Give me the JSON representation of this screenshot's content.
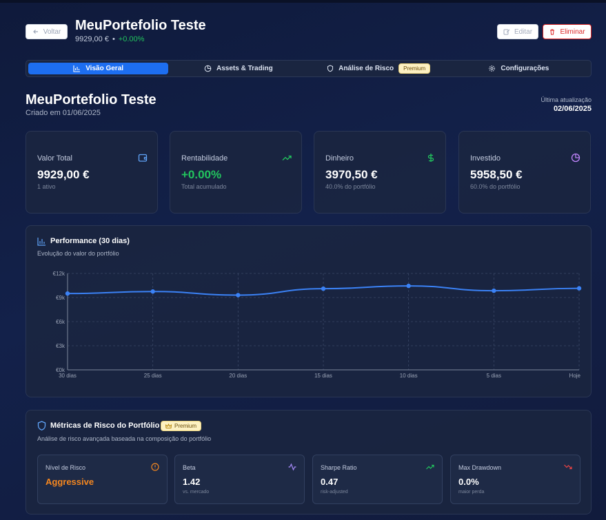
{
  "header": {
    "back_label": "Voltar",
    "title": "MeuPortefolio Teste",
    "value": "9929,00 €",
    "separator": "•",
    "change": "+0.00%",
    "edit_label": "Editar",
    "delete_label": "Eliminar"
  },
  "tabs": [
    {
      "label": "Visão Geral",
      "icon": "bar-chart-icon",
      "active": true
    },
    {
      "label": "Assets & Trading",
      "icon": "pie-chart-icon",
      "active": false
    },
    {
      "label": "Análise de Risco",
      "icon": "shield-icon",
      "active": false,
      "badge": "Premium"
    },
    {
      "label": "Configurações",
      "icon": "gear-icon",
      "active": false
    }
  ],
  "overview": {
    "title": "MeuPortefolio Teste",
    "created": "Criado em 01/06/2025",
    "update_label": "Última atualização",
    "update_date": "02/06/2025"
  },
  "stats": [
    {
      "label": "Valor Total",
      "value": "9929,00 €",
      "sub": "1 ativo",
      "icon": "wallet-icon",
      "color": "#60a5fa"
    },
    {
      "label": "Rentabilidade",
      "value": "+0.00%",
      "sub": "Total acumulado",
      "icon": "trending-up-icon",
      "color": "#22c55e"
    },
    {
      "label": "Dinheiro",
      "value": "3970,50 €",
      "sub": "40.0% do portfólio",
      "icon": "dollar-icon",
      "color": "#22c55e"
    },
    {
      "label": "Investido",
      "value": "5958,50 €",
      "sub": "60.0% do portfólio",
      "icon": "pie-chart-icon",
      "color": "#c084fc"
    }
  ],
  "performance": {
    "title": "Performance (30 dias)",
    "subtitle": "Evolução do valor do portfólio"
  },
  "chart_data": {
    "type": "line",
    "categories": [
      "30 dias",
      "25 dias",
      "20 dias",
      "15 dias",
      "10 dias",
      "5 dias",
      "Hoje"
    ],
    "series": [
      {
        "values": [
          9500,
          9750,
          9300,
          10100,
          10450,
          9850,
          10150
        ]
      }
    ],
    "y_ticks": [
      "€0k",
      "€3k",
      "€6k",
      "€9k",
      "€12k"
    ],
    "ylim": [
      0,
      12000
    ],
    "grid": true,
    "line_color": "#3b82f6"
  },
  "risk": {
    "title": "Métricas de Risco do Portfólio",
    "badge": "Premium",
    "subtitle": "Análise de risco avançada baseada na composição do portfólio",
    "metrics": [
      {
        "label": "Nível de Risco",
        "value": "Aggressive",
        "sub": "",
        "icon": "alert-circle-icon",
        "color": "#f5871f"
      },
      {
        "label": "Beta",
        "value": "1.42",
        "sub": "vs. mercado",
        "icon": "activity-icon",
        "color": "#a78bfa"
      },
      {
        "label": "Sharpe Ratio",
        "value": "0.47",
        "sub": "risk-adjusted",
        "icon": "trending-up-icon",
        "color": "#22c55e"
      },
      {
        "label": "Max Drawdown",
        "value": "0.0%",
        "sub": "maior perda",
        "icon": "trending-down-icon",
        "color": "#ef4444"
      }
    ]
  }
}
